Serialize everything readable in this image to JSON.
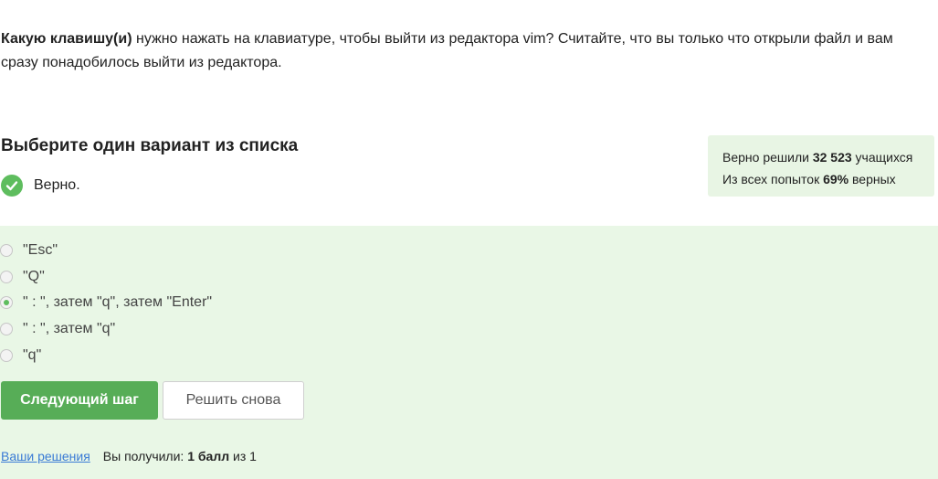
{
  "question": {
    "bold": "Какую клавишу(и)",
    "text": " нужно нажать на клавиатуре, чтобы выйти из редактора vim? Считайте, что вы только что открыли файл и вам сразу понадобилось выйти из редактора."
  },
  "section_title": "Выберите один вариант из списка",
  "verdict": {
    "icon": "check-circle-icon",
    "text": "Верно."
  },
  "stats": {
    "line1_prefix": "Верно решили ",
    "line1_count": "32 523",
    "line1_suffix": " учащихся",
    "line2_prefix": "Из всех попыток ",
    "line2_percent": "69%",
    "line2_suffix": " верных"
  },
  "options": [
    {
      "label": "\"Esc\"",
      "checked": false
    },
    {
      "label": "\"Q\"",
      "checked": false
    },
    {
      "label": "\" : \", затем \"q\", затем \"Enter\"",
      "checked": true
    },
    {
      "label": "\" : \", затем \"q\"",
      "checked": false
    },
    {
      "label": "\"q\"",
      "checked": false
    }
  ],
  "buttons": {
    "next": "Следующий шаг",
    "retry": "Решить снова"
  },
  "footer": {
    "link": "Ваши решения",
    "score_prefix": "Вы получили: ",
    "score_value": "1 балл",
    "score_suffix": " из 1"
  },
  "colors": {
    "accent": "#57ad57",
    "answer_bg": "#e9f7e6",
    "stats_bg": "#e8f5e4",
    "link": "#3a7bd5"
  }
}
